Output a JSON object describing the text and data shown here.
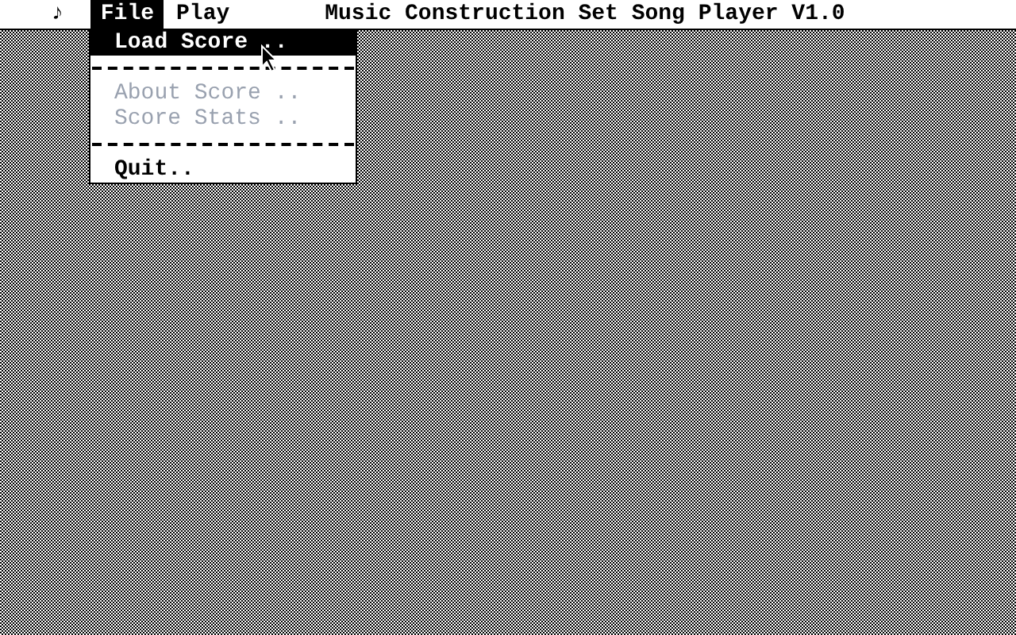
{
  "menu_bar": {
    "menus": [
      {
        "label": "♪",
        "selected": false
      },
      {
        "label": "File",
        "selected": true
      },
      {
        "label": "Play",
        "selected": false
      }
    ],
    "title": "Music Construction Set Song Player V1.0"
  },
  "dropdown": {
    "items": [
      {
        "kind": "item",
        "label": "Load Score ..",
        "selected": true,
        "disabled": false
      },
      {
        "kind": "separator"
      },
      {
        "kind": "item",
        "label": "About Score ..",
        "selected": false,
        "disabled": true
      },
      {
        "kind": "item",
        "label": "Score Stats ..",
        "selected": false,
        "disabled": true
      },
      {
        "kind": "separator"
      },
      {
        "kind": "item",
        "label": "Quit..",
        "selected": false,
        "disabled": false
      }
    ]
  }
}
